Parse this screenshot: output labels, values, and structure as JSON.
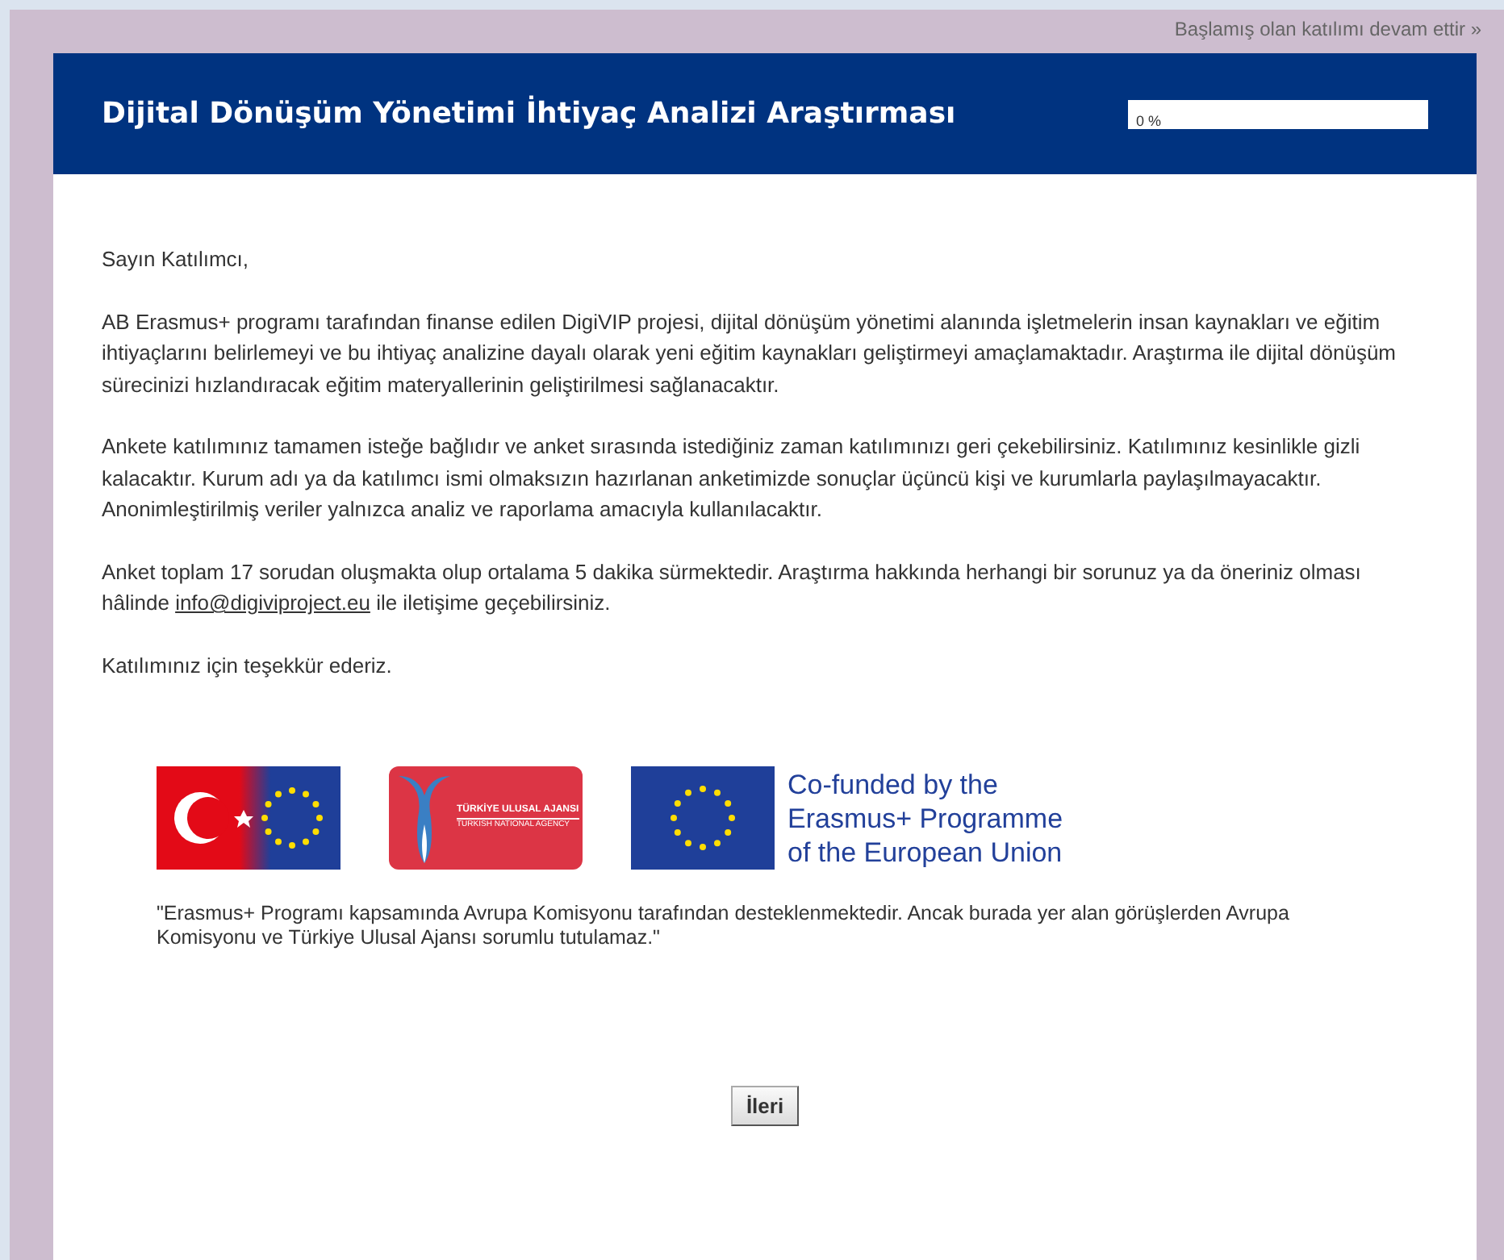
{
  "resume_link": "Başlamış olan katılımı devam ettir »",
  "header": {
    "title": "Dijital Dönüşüm Yönetimi İhtiyaç Analizi Araştırması",
    "progress": {
      "level": 0,
      "reading": "0 %"
    }
  },
  "body": {
    "greeting": "Sayın Katılımcı,",
    "paragraphs": [
      "AB Erasmus+ programı tarafından finanse edilen DigiVIP projesi, dijital dönüşüm yönetimi alanında işletmelerin insan kaynakları ve eğitim ihtiyaçlarını belirlemeyi ve bu ihtiyaç analizine dayalı olarak yeni eğitim kaynakları geliştirmeyi amaçlamaktadır. Araştırma ile dijital dönüşüm sürecinizi hızlandıracak eğitim materyallerinin geliştirilmesi sağlanacaktır.",
      "Ankete katılımınız tamamen isteğe bağlıdır ve anket sırasında istediğiniz zaman katılımınızı geri çekebilirsiniz. Katılımınız kesinlikle gizli kalacaktır. Kurum adı ya da katılımcı ismi olmaksızın hazırlanan anketimizde sonuçlar üçüncü kişi ve kurumlarla paylaşılmayacaktır. Anonimleştirilmiş veriler yalnızca analiz ve raporlama amacıyla kullanılacaktır."
    ],
    "contact": {
      "text_before": "Anket toplam 17 sorudan oluşmakta olup ortalama 5 dakika sürmektedir. Araştırma hakkında herhangi bir sorunuz ya da öneriniz olması hâlinde",
      "email": "info@digiviproject.eu",
      "text_after": "ile iletişime geçebilirsiniz."
    },
    "thanks": "Katılımınız için teşekkür ederiz."
  },
  "logos": {
    "agency_name": "TÜRKİYE ULUSAL AJANSI",
    "agency_subtitle": "TURKISH NATIONAL AGENCY",
    "cofunded_lines": [
      "Co-funded by the",
      "Erasmus+ Programme",
      "of the European Union"
    ]
  },
  "disclaimer": "\"Erasmus+ Programı kapsamında Avrupa Komisyonu tarafından desteklenmektedir. Ancak burada yer alan görüşlerden Avrupa Komisyonu ve Türkiye Ulusal Ajansı sorumlu tutulamaz.\"",
  "next_button": "İleri"
}
